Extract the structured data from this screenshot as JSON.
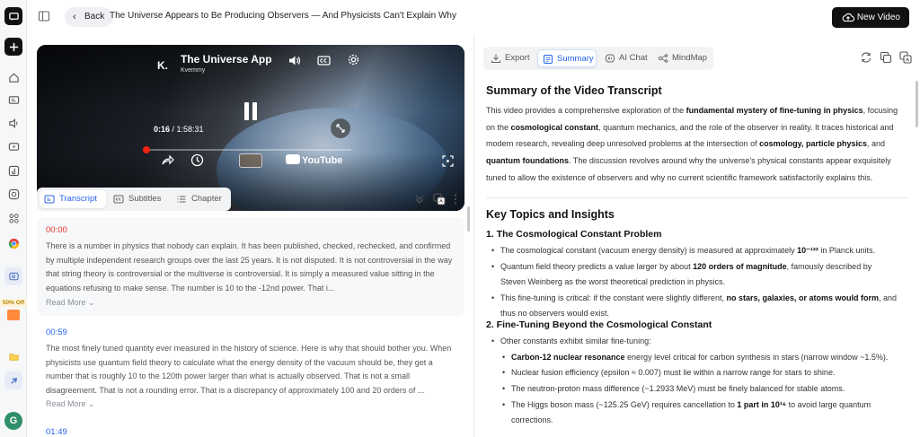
{
  "topbar": {
    "back_label": "Back",
    "title": "The Universe Appears to Be Producing Observers — And Physicists Can't Explain Why",
    "new_video_label": "New Video"
  },
  "video": {
    "title": "The Universe Appe",
    "channel": "Kvemmy",
    "channel_initial": "K.",
    "current_time": "0:16",
    "duration": "/ 1:58:31",
    "youtube_label": "YouTube",
    "progress": 0.01
  },
  "left_tabs": [
    {
      "label": "Transcript",
      "active": true
    },
    {
      "label": "Subtitles",
      "active": false
    },
    {
      "label": "Chapter",
      "active": false
    }
  ],
  "segments": [
    {
      "time": "00:00",
      "text": "There is a number in physics that nobody can explain. It has been published, checked, rechecked, and confirmed by multiple independent research groups over the last 25 years. It is not disputed. It is not controversial in the way that string theory is controversial or the multiverse is controversial. It is simply a measured value sitting in the equations refusing to make sense. The number is 10 to the -12nd power. That i...",
      "read_more": "Read More"
    },
    {
      "time": "00:59",
      "text": "The most finely tuned quantity ever measured in the history of science. Here is why that should bother you. When physicists use quantum field theory to calculate what the energy density of the vacuum should be, they get a number that is roughly 10 to the 120th power larger than what is actually observed. That is not a small disagreement. That is not a rounding error. That is a discrepancy of approximately 100 and 20 orders of ...",
      "read_more": "Read More"
    },
    {
      "time": "01:49"
    }
  ],
  "right_tabs": [
    {
      "label": "Export",
      "active": false
    },
    {
      "label": "Summary",
      "active": true
    },
    {
      "label": "AI Chat",
      "active": false
    },
    {
      "label": "MindMap",
      "active": false
    }
  ],
  "summary": {
    "heading": "Summary of the Video Transcript",
    "p1a": "This video provides a comprehensive exploration of the ",
    "p1b": "fundamental mystery of fine-tuning in physics",
    "p1c": ", focusing on the ",
    "p1d": "cosmological constant",
    "p1e": ", quantum mechanics, and the role of the observer in reality. It traces historical and modern research, revealing deep unresolved problems at the intersection of ",
    "p1f": "cosmology, particle physics",
    "p1g": ", and ",
    "p1h": "quantum foundations",
    "p1i": ". The discussion revolves around why the universe's physical constants appear exquisitely tuned to allow the existence of observers and why no current scientific framework satisfactorily explains this.",
    "topics_heading": "Key Topics and Insights",
    "s1_heading": "1. The Cosmological Constant Problem",
    "s1_b1a": "The cosmological constant (vacuum energy density) is measured at approximately ",
    "s1_b1b": "10⁻¹²²",
    "s1_b1c": " in Planck units.",
    "s1_b2a": "Quantum field theory predicts a value larger by about ",
    "s1_b2b": "120 orders of magnitude",
    "s1_b2c": ", famously described by Steven Weinberg as the worst theoretical prediction in physics.",
    "s1_b3a": "This fine-tuning is critical: if the constant were slightly different, ",
    "s1_b3b": "no stars, galaxies, or atoms would form",
    "s1_b3c": ", and thus no observers would exist.",
    "s2_heading": "2. Fine-Tuning Beyond the Cosmological Constant",
    "s2_b0": "Other constants exhibit similar fine-tuning:",
    "s2_b1a": "Carbon-12 nuclear resonance",
    "s2_b1b": " energy level critical for carbon synthesis in stars (narrow window ~1.5%).",
    "s2_b2": "Nuclear fusion efficiency (epsilon ≈ 0.007) must lie within a narrow range for stars to shine.",
    "s2_b3": "The neutron-proton mass difference (~1.2933 MeV) must be finely balanced for stable atoms.",
    "s2_b4a": "The Higgs boson mass (~125.25 GeV) requires cancellation to ",
    "s2_b4b": "1 part in 10¹⁶",
    "s2_b4c": " to avoid large quantum corrections."
  },
  "rail": {
    "promo": "50% Off",
    "avatar": "G"
  },
  "colors": {
    "accent": "#2563eb",
    "timestamp_red": "#e03131",
    "dark": "#111111"
  }
}
